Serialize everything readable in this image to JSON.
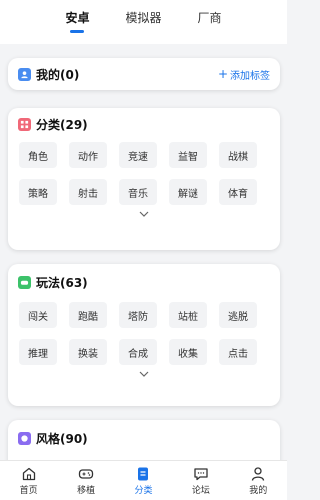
{
  "top_tabs": [
    "安卓",
    "模拟器",
    "厂商"
  ],
  "mine": {
    "title": "我的(0)",
    "action_label": "添加标签",
    "icon_color": "#4a8df0"
  },
  "category": {
    "title": "分类(29)",
    "icon_color": "#f06878",
    "tags": [
      "角色",
      "动作",
      "竞速",
      "益智",
      "战棋",
      "策略",
      "射击",
      "音乐",
      "解谜",
      "体育"
    ]
  },
  "gameplay": {
    "title": "玩法(63)",
    "icon_color": "#3cc26a",
    "tags": [
      "闯关",
      "跑酷",
      "塔防",
      "站桩",
      "逃脱",
      "推理",
      "换装",
      "合成",
      "收集",
      "点击"
    ]
  },
  "style": {
    "title": "风格(90)",
    "icon_color": "#8a6cf0"
  },
  "bottom_nav": {
    "home": "首页",
    "port": "移植",
    "category": "分类",
    "forum": "论坛",
    "mine": "我的"
  },
  "colors": {
    "accent": "#1a73e8",
    "tag_bg": "#f2f3f5"
  }
}
